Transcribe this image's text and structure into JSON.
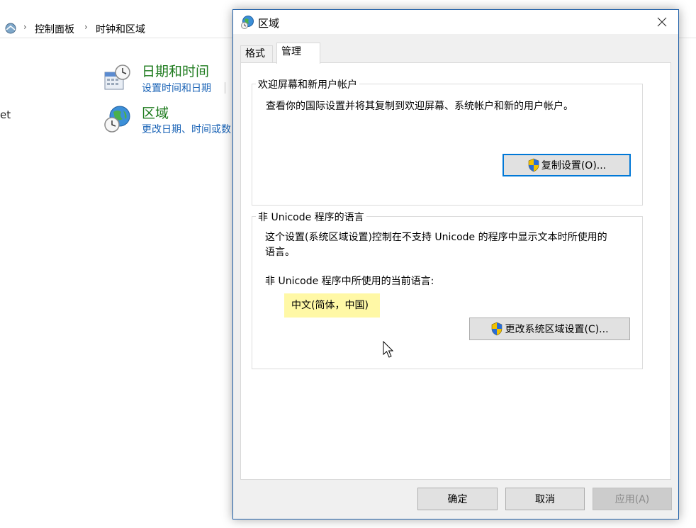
{
  "background": {
    "breadcrumb": [
      "控制面板",
      "时钟和区域"
    ],
    "left_fragment": "et",
    "categories": [
      {
        "title": "日期和时间",
        "link": "设置时间和日期"
      },
      {
        "title": "区域",
        "link": "更改日期、时间或数"
      }
    ]
  },
  "dialog": {
    "title": "区域",
    "tabs": [
      "格式",
      "管理"
    ],
    "active_tab": "管理",
    "welcome_group": {
      "legend": "欢迎屏幕和新用户帐户",
      "description": "查看你的国际设置并将其复制到欢迎屏幕、系统帐户和新的用户帐户。",
      "button": "复制设置(O)..."
    },
    "unicode_group": {
      "legend": "非 Unicode 程序的语言",
      "description_line1": "这个设置(系统区域设置)控制在不支持 Unicode 的程序中显示文本时所使用的",
      "description_line2": "语言。",
      "current_label": "非 Unicode 程序中所使用的当前语言:",
      "current_value": "中文(简体，中国)",
      "button": "更改系统区域设置(C)..."
    },
    "footer": {
      "ok": "确定",
      "cancel": "取消",
      "apply": "应用(A)"
    }
  },
  "colors": {
    "accent_border": "#1f5fa8",
    "category_title": "#1e7b1e",
    "link": "#1a63b6",
    "highlight": "#fff8a6"
  },
  "icons": [
    "control-panel-icon",
    "chevron-right-icon",
    "calendar-clock-icon",
    "globe-clock-icon",
    "globe-icon",
    "close-icon",
    "uac-shield-icon",
    "mouse-cursor-icon"
  ]
}
